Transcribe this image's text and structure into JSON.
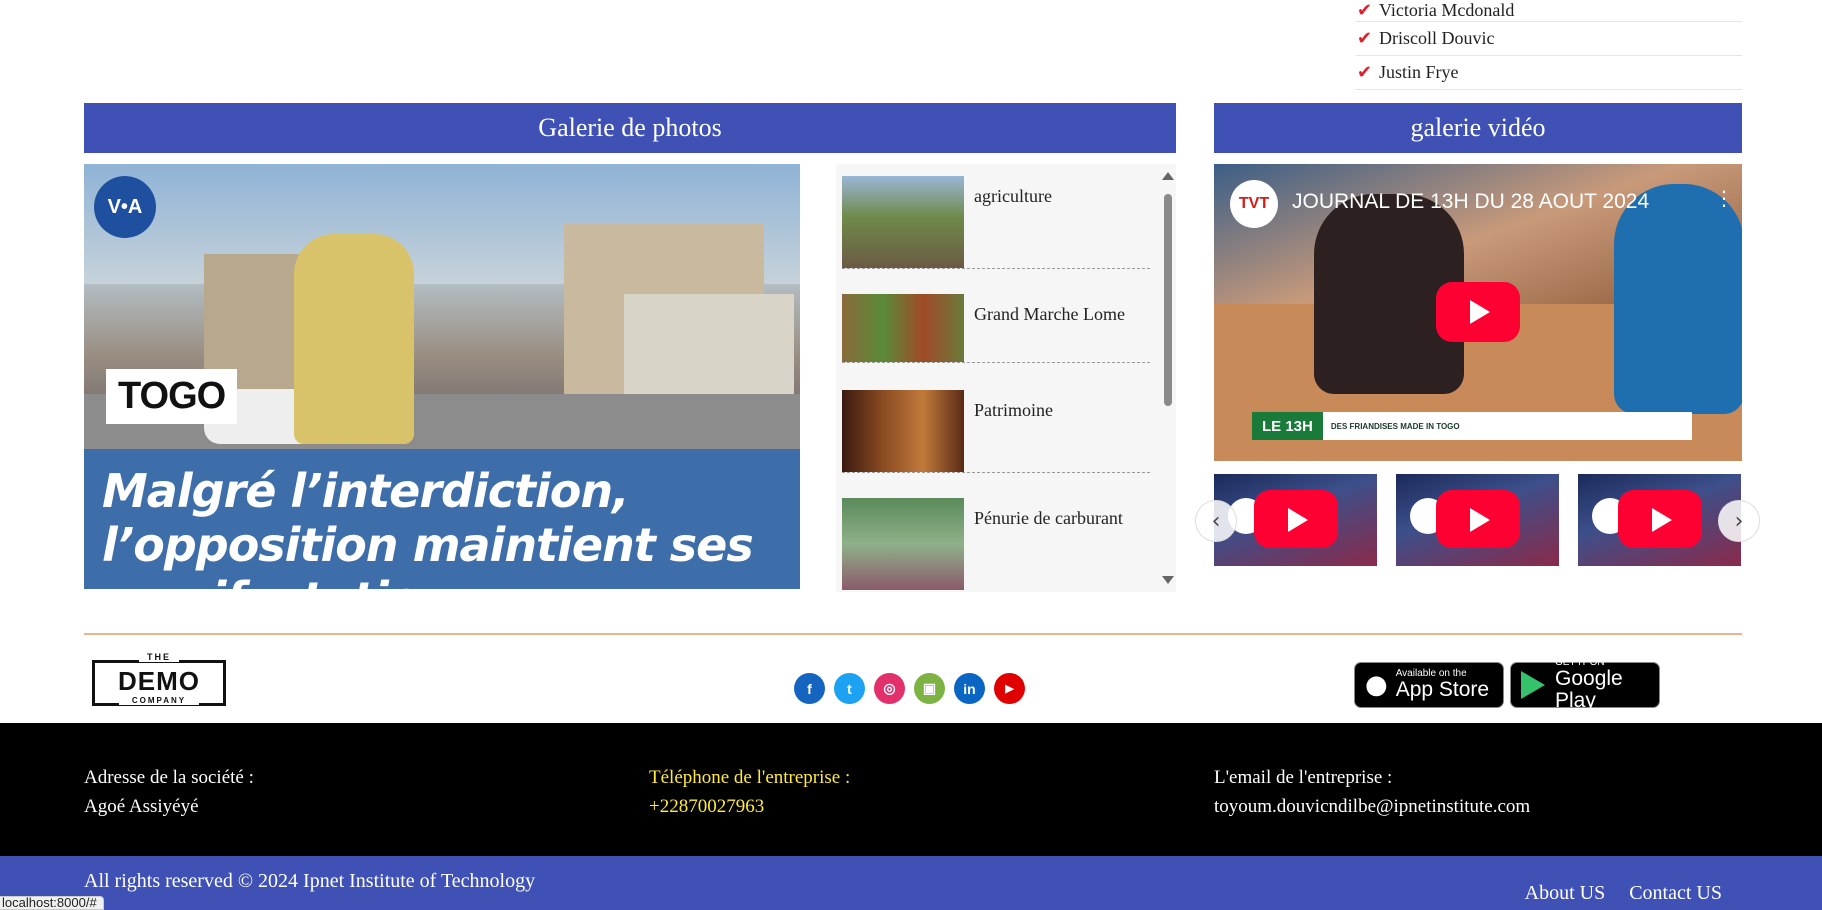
{
  "top_list": {
    "items": [
      "Victoria Mcdonald",
      "Driscoll Douvic",
      "Justin Frye"
    ]
  },
  "photo_gallery": {
    "title": "Galerie de photos",
    "main": {
      "logo_text": "V•A",
      "tag": "TOGO",
      "headline": "Malgré l’interdiction, l’opposition maintient ses manifestations"
    },
    "thumbnails": [
      {
        "label": "agriculture",
        "color": "#6f8a4a"
      },
      {
        "label": "Grand Marche Lome",
        "color": "#8a6a3a"
      },
      {
        "label": "Patrimoine",
        "color": "#6a3a22"
      },
      {
        "label": "Pénurie de carburant",
        "color": "#5a8a5a"
      }
    ]
  },
  "video_gallery": {
    "title": "galerie vidéo",
    "main": {
      "channel": "TVT",
      "title": "JOURNAL DE 13H DU 28 AOUT 2024",
      "lower_badge": "LE 13H",
      "lower_text": "DES FRIANDISES MADE IN TOGO"
    },
    "thumbs": [
      {
        "id": 1
      },
      {
        "id": 2
      },
      {
        "id": 3
      }
    ],
    "prev_icon": "chevron-left-icon",
    "next_icon": "chevron-right-icon"
  },
  "brand": {
    "the": "THE",
    "name": "DEMO",
    "company": "COMPANY"
  },
  "social": [
    {
      "icon": "facebook-icon",
      "glyph": "f",
      "color": "#1565c0"
    },
    {
      "icon": "twitter-icon",
      "glyph": "t",
      "color": "#1da1f2"
    },
    {
      "icon": "instagram-icon",
      "glyph": "◎",
      "color": "#e1306c"
    },
    {
      "icon": "android-icon",
      "glyph": "▣",
      "color": "#7cb342"
    },
    {
      "icon": "linkedin-icon",
      "glyph": "in",
      "color": "#0a66c2"
    },
    {
      "icon": "youtube-icon",
      "glyph": "▶",
      "color": "#e00000"
    }
  ],
  "stores": {
    "apple_small": "Available on the",
    "apple_big": "App Store",
    "google_small": "GET IT ON",
    "google_big": "Google Play"
  },
  "footer": {
    "address_label": "Adresse de la société :",
    "address_value": "Agoé Assiyéyé",
    "phone_label": "Téléphone de l'entreprise :",
    "phone_value": "+22870027963",
    "email_label": "L'email de l'entreprise :",
    "email_value": "toyoum.douvicndilbe@ipnetinstitute.com",
    "colors": {
      "phone": "#ffeb3b",
      "text": "#ffffff"
    }
  },
  "bottom": {
    "rights": "All rights reserved © 2024 Ipnet Institute of Technology",
    "about": "About US",
    "contact": "Contact US"
  },
  "status_url": "localhost:8000/#"
}
